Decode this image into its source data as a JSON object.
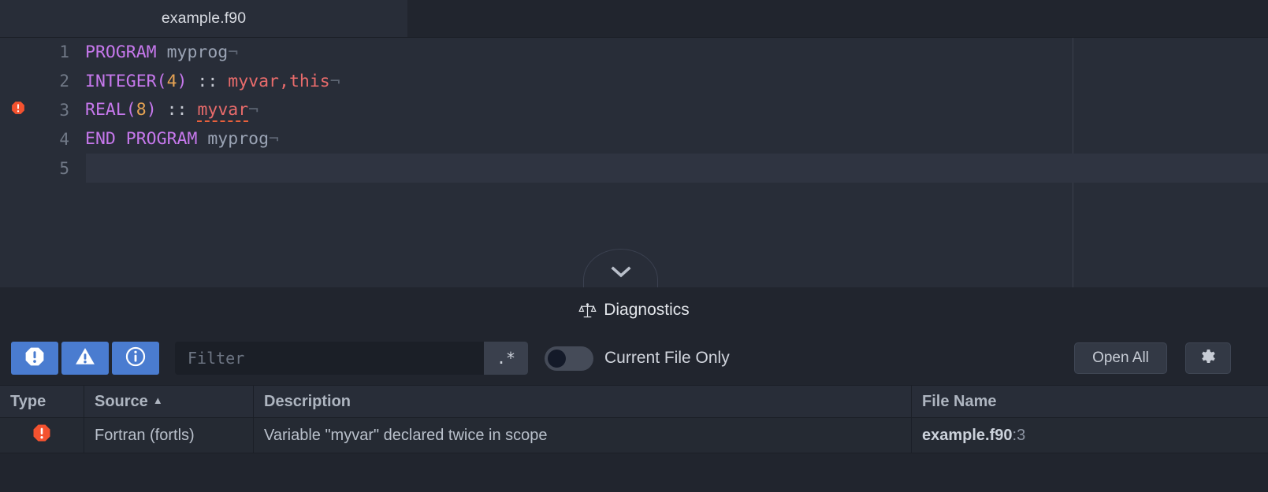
{
  "tabbar": {
    "tabs": [
      {
        "label": "example.f90",
        "active": true
      }
    ]
  },
  "editor": {
    "language": "fortran",
    "eol_marker": "¬",
    "lines": [
      {
        "number": "1",
        "has_error_marker": false,
        "tokens": [
          {
            "text": "PROGRAM",
            "kind": "keyword"
          },
          {
            "text": " ",
            "kind": "plain"
          },
          {
            "text": "myprog",
            "kind": "identifier"
          },
          {
            "text": "¬",
            "kind": "eol"
          }
        ]
      },
      {
        "number": "2",
        "has_error_marker": false,
        "tokens": [
          {
            "text": "INTEGER",
            "kind": "keyword"
          },
          {
            "text": "(",
            "kind": "keyword"
          },
          {
            "text": "4",
            "kind": "number"
          },
          {
            "text": ")",
            "kind": "keyword"
          },
          {
            "text": " ",
            "kind": "plain"
          },
          {
            "text": "::",
            "kind": "operator"
          },
          {
            "text": " ",
            "kind": "plain"
          },
          {
            "text": "myvar",
            "kind": "variable"
          },
          {
            "text": ",",
            "kind": "variable"
          },
          {
            "text": "this",
            "kind": "variable"
          },
          {
            "text": "¬",
            "kind": "eol"
          }
        ]
      },
      {
        "number": "3",
        "has_error_marker": true,
        "tokens": [
          {
            "text": "REAL",
            "kind": "keyword"
          },
          {
            "text": "(",
            "kind": "keyword"
          },
          {
            "text": "8",
            "kind": "number"
          },
          {
            "text": ")",
            "kind": "keyword"
          },
          {
            "text": " ",
            "kind": "plain"
          },
          {
            "text": "::",
            "kind": "operator"
          },
          {
            "text": " ",
            "kind": "plain"
          },
          {
            "text": "myvar",
            "kind": "variable-error"
          },
          {
            "text": "¬",
            "kind": "eol"
          }
        ]
      },
      {
        "number": "4",
        "has_error_marker": false,
        "tokens": [
          {
            "text": "END",
            "kind": "keyword"
          },
          {
            "text": " ",
            "kind": "plain"
          },
          {
            "text": "PROGRAM",
            "kind": "keyword"
          },
          {
            "text": " ",
            "kind": "plain"
          },
          {
            "text": "myprog",
            "kind": "identifier"
          },
          {
            "text": "¬",
            "kind": "eol"
          }
        ]
      },
      {
        "number": "5",
        "has_error_marker": false,
        "current": true,
        "tokens": []
      }
    ]
  },
  "panel": {
    "title": "Diagnostics",
    "title_icon": "scales-icon",
    "collapse_icon": "chevron-down-icon",
    "toolbar": {
      "severity_filters": [
        {
          "name": "error",
          "icon": "error-octagon-icon",
          "active": true
        },
        {
          "name": "warning",
          "icon": "warning-triangle-icon",
          "active": true
        },
        {
          "name": "info",
          "icon": "info-circle-icon",
          "active": true
        }
      ],
      "filter": {
        "value": "",
        "placeholder": "Filter",
        "regex_button_label": ".*"
      },
      "current_file_only": {
        "label": "Current File Only",
        "enabled": false
      },
      "open_all_label": "Open All",
      "settings_icon": "gear-icon"
    },
    "table": {
      "columns": [
        {
          "key": "type",
          "label": "Type",
          "sorted": false
        },
        {
          "key": "source",
          "label": "Source",
          "sorted": true,
          "sort_direction": "asc",
          "sort_glyph": "▲"
        },
        {
          "key": "description",
          "label": "Description",
          "sorted": false
        },
        {
          "key": "file_name",
          "label": "File Name",
          "sorted": false
        }
      ],
      "rows": [
        {
          "type_icon": "error-octagon-icon",
          "source": "Fortran (fortls)",
          "description": "Variable \"myvar\" declared twice in scope",
          "file_name": "example.f90",
          "file_line": ":3"
        }
      ]
    }
  },
  "colors": {
    "editor_bg": "#282d38",
    "panel_bg": "#21252e",
    "tab_active_bg": "#282d38",
    "accent_blue": "#4a7cd0",
    "error_red": "#f4522f",
    "keyword_magenta": "#c678ec",
    "number_orange": "#e5a253",
    "variable_red": "#e86b6b",
    "identifier_grey": "#9aa3b4",
    "row_bg": "#252a33",
    "header_bg": "#282d38",
    "grid_line": "#1b1f27"
  }
}
